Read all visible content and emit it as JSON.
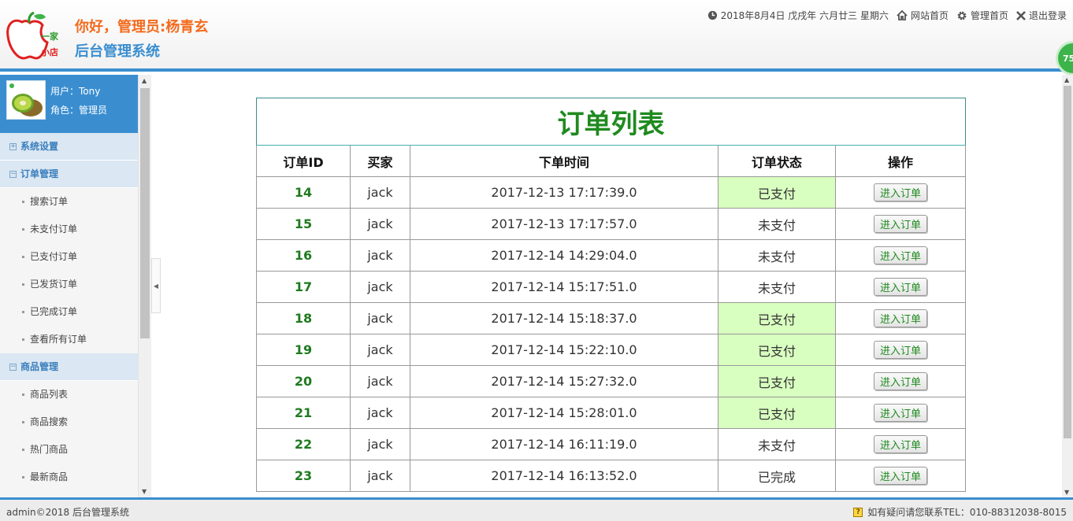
{
  "header": {
    "logo_text_top": "一家",
    "logo_text_bottom": "小店",
    "greeting": "你好，管理员:杨青玄",
    "system_title": "后台管理系统",
    "date": "2018年8月4日 戊戌年 六月廿三 星期六",
    "nav": [
      {
        "label": "网站首页",
        "icon": "home-icon"
      },
      {
        "label": "管理首页",
        "icon": "gear-icon"
      },
      {
        "label": "退出登录",
        "icon": "close-icon"
      }
    ],
    "badge": "75"
  },
  "sidebar": {
    "user_label": "用户：Tony",
    "role_label": "角色：管理员",
    "menu": [
      {
        "type": "section",
        "label": "系统设置",
        "symbol": "+"
      },
      {
        "type": "section",
        "label": "订单管理",
        "symbol": "−"
      },
      {
        "type": "item",
        "label": "搜索订单"
      },
      {
        "type": "item",
        "label": "未支付订单"
      },
      {
        "type": "item",
        "label": "已支付订单"
      },
      {
        "type": "item",
        "label": "已发货订单"
      },
      {
        "type": "item",
        "label": "已完成订单"
      },
      {
        "type": "item",
        "label": "查看所有订单"
      },
      {
        "type": "section",
        "label": "商品管理",
        "symbol": "−"
      },
      {
        "type": "item",
        "label": "商品列表"
      },
      {
        "type": "item",
        "label": "商品搜索"
      },
      {
        "type": "item",
        "label": "热门商品"
      },
      {
        "type": "item",
        "label": "最新商品"
      }
    ]
  },
  "orders": {
    "title": "订单列表",
    "columns": [
      "订单ID",
      "买家",
      "下单时间",
      "订单状态",
      "操作"
    ],
    "action_label": "进入订单",
    "rows": [
      {
        "id": "14",
        "buyer": "jack",
        "time": "2017-12-13 17:17:39.0",
        "status": "已支付"
      },
      {
        "id": "15",
        "buyer": "jack",
        "time": "2017-12-13 17:17:57.0",
        "status": "未支付"
      },
      {
        "id": "16",
        "buyer": "jack",
        "time": "2017-12-14 14:29:04.0",
        "status": "未支付"
      },
      {
        "id": "17",
        "buyer": "jack",
        "time": "2017-12-14 15:17:51.0",
        "status": "未支付"
      },
      {
        "id": "18",
        "buyer": "jack",
        "time": "2017-12-14 15:18:37.0",
        "status": "已支付"
      },
      {
        "id": "19",
        "buyer": "jack",
        "time": "2017-12-14 15:22:10.0",
        "status": "已支付"
      },
      {
        "id": "20",
        "buyer": "jack",
        "time": "2017-12-14 15:27:32.0",
        "status": "已支付"
      },
      {
        "id": "21",
        "buyer": "jack",
        "time": "2017-12-14 15:28:01.0",
        "status": "已支付"
      },
      {
        "id": "22",
        "buyer": "jack",
        "time": "2017-12-14 16:11:19.0",
        "status": "未支付"
      },
      {
        "id": "23",
        "buyer": "jack",
        "time": "2017-12-14 16:13:52.0",
        "status": "已完成"
      }
    ]
  },
  "footer": {
    "copyright": "admin©2018 后台管理系统",
    "contact": "如有疑问请您联系TEL：010-88312038-8015"
  },
  "colors": {
    "accent": "#3a8ed0",
    "greeting": "#f26b1d",
    "title_green": "#1f8a1f",
    "paid_bg": "#d8ffc0"
  }
}
